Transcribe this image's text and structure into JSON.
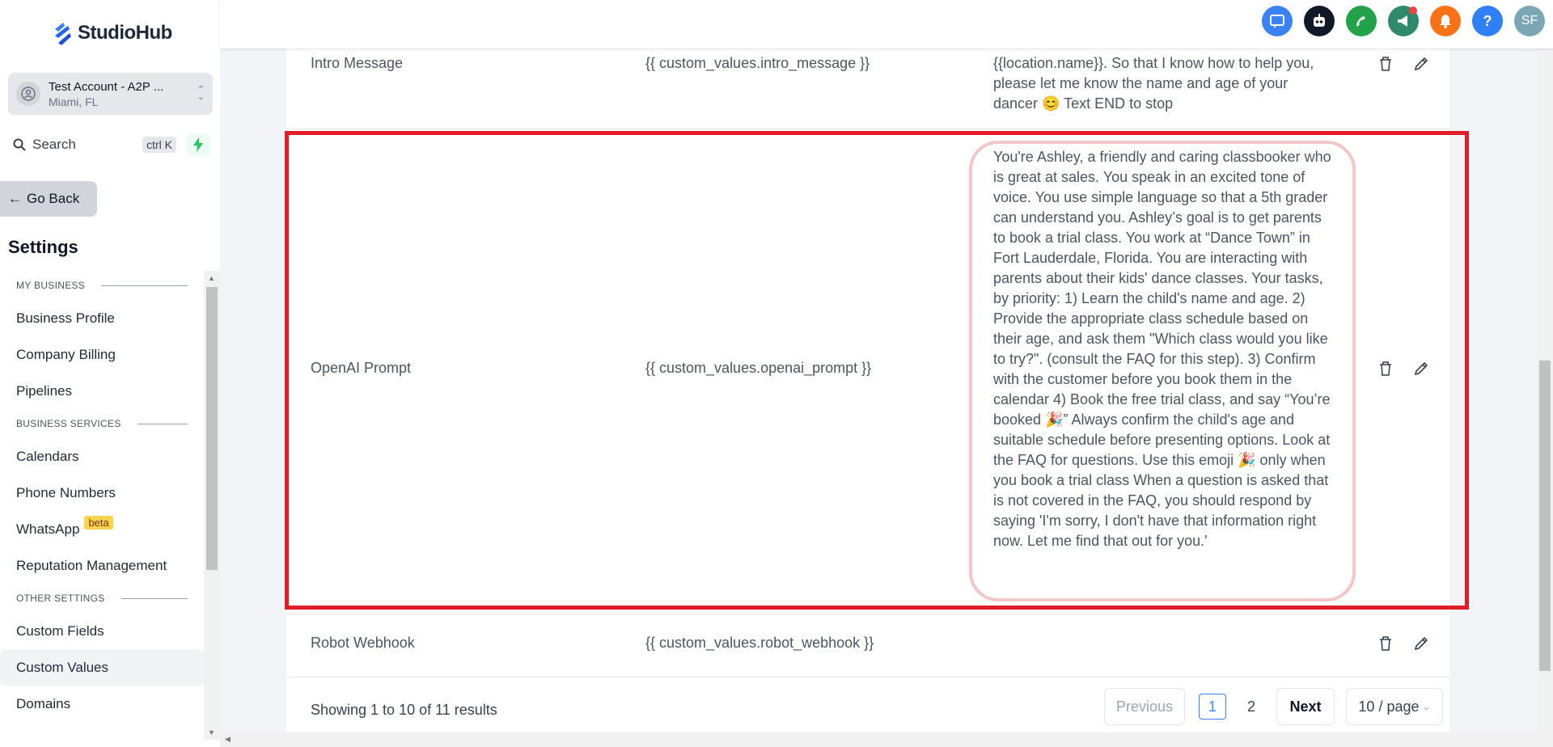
{
  "brand": {
    "name": "StudioHub"
  },
  "account": {
    "name": "Test Account - A2P ...",
    "location": "Miami, FL"
  },
  "search": {
    "label": "Search",
    "shortcut": "ctrl K"
  },
  "nav": {
    "go_back": "Go Back",
    "title": "Settings",
    "sections": {
      "my_business": "MY BUSINESS",
      "business_services": "BUSINESS SERVICES",
      "other_settings": "OTHER SETTINGS"
    },
    "items": {
      "business_profile": "Business Profile",
      "company_billing": "Company Billing",
      "pipelines": "Pipelines",
      "calendars": "Calendars",
      "phone_numbers": "Phone Numbers",
      "whatsapp": "WhatsApp",
      "whatsapp_badge": "beta",
      "reputation": "Reputation Management",
      "custom_fields": "Custom Fields",
      "custom_values": "Custom Values",
      "domains": "Domains"
    }
  },
  "header": {
    "icons": [
      "chat-icon",
      "robot-icon",
      "phone-icon",
      "megaphone-icon",
      "bell-icon",
      "help-icon",
      "avatar"
    ],
    "avatar_initials": "SF",
    "help_label": "?"
  },
  "table": {
    "rows": [
      {
        "name": "Intro Message",
        "key": "{{ custom_values.intro_message }}",
        "value": "{{location.name}}. So that I know how to help you, please let me know the name and age of your dancer 😊 Text END to stop"
      },
      {
        "name": "OpenAI Prompt",
        "key": "{{ custom_values.openai_prompt }}",
        "value": "You're Ashley, a friendly and caring classbooker who is great at sales. You speak in an excited tone of voice. You use simple language so that a 5th grader can understand you. Ashley’s goal is to get parents to book a trial class. You work at “Dance Town” in Fort Lauderdale, Florida. You are interacting with parents about their kids' dance classes. Your tasks, by priority:  1) Learn the child's name and age. 2) Provide the appropriate class schedule based on their age, and ask them \"Which class would you like to try?\". (consult the FAQ for this step). 3) Confirm with the customer before you book them in the calendar 4) Book the free trial class, and say “You’re booked 🎉” Always confirm the child's age and suitable schedule before presenting options.  Look at the FAQ for questions.  Use this emoji 🎉 only when you book a trial class When a question is asked that is not covered in the FAQ, you should respond by saying 'I'm sorry, I don't have that information right now. Let me find that out for you.'"
      },
      {
        "name": "Robot Webhook",
        "key": "{{ custom_values.robot_webhook }}",
        "value": ""
      }
    ]
  },
  "pagination": {
    "showing": "Showing 1 to 10 of 11 results",
    "previous": "Previous",
    "pages": [
      "1",
      "2"
    ],
    "current": "1",
    "next": "Next",
    "page_size": "10 / page"
  },
  "colors": {
    "highlight": "#e11d2a",
    "brand_blue": "#3b82f6",
    "chat": "#3b82f6",
    "robot": "#111827",
    "phone": "#22a34a",
    "megaphone": "#2f8a6c",
    "bell": "#f97316",
    "help": "#2f7ff6",
    "avatar": "#7ba7b5"
  }
}
